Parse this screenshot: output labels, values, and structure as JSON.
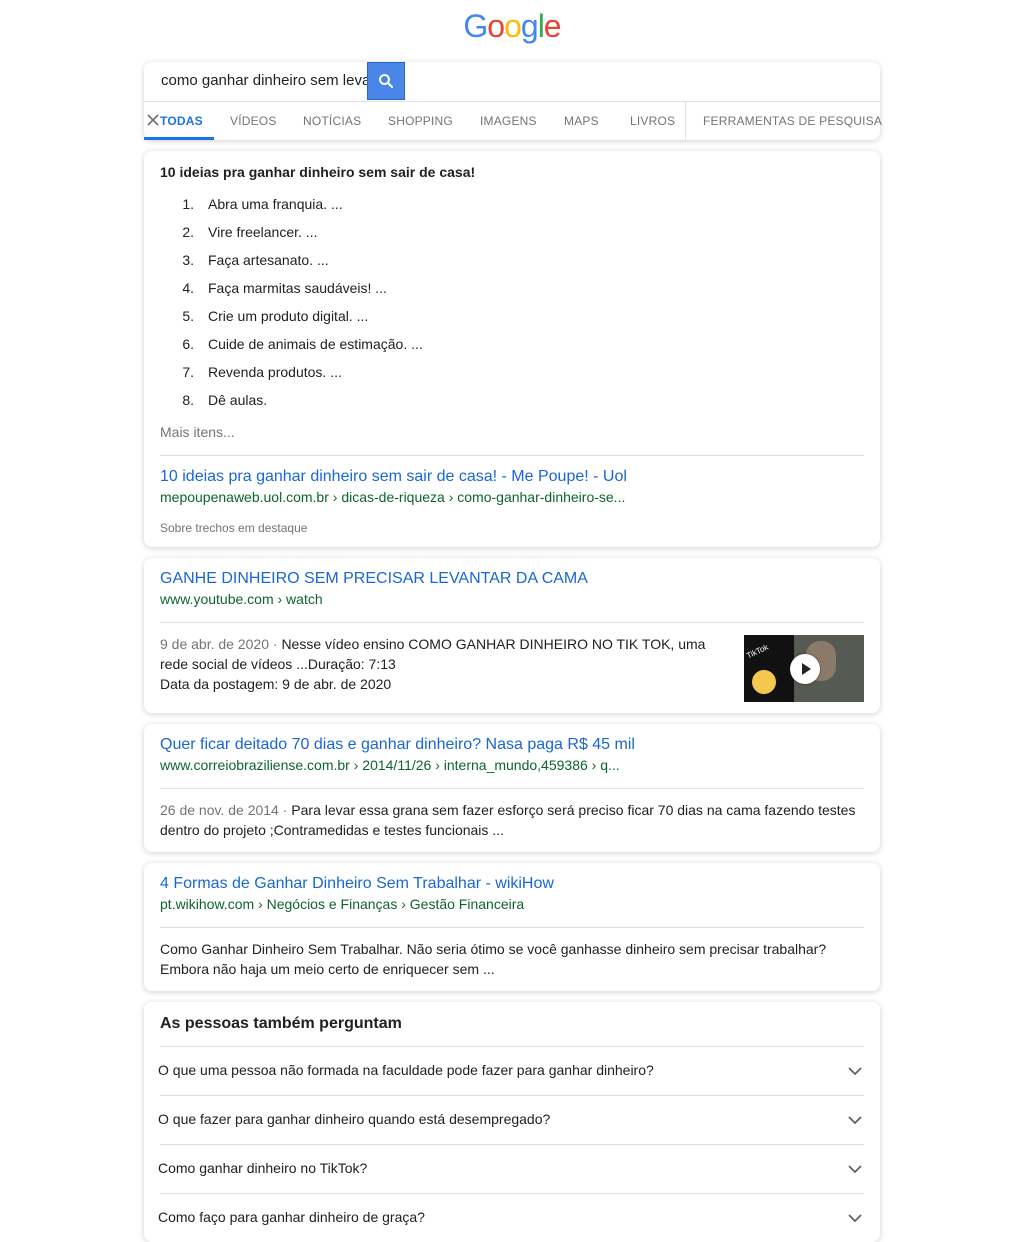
{
  "logo": {
    "letters": [
      "G",
      "o",
      "o",
      "g",
      "l",
      "e"
    ],
    "colors": [
      "#4285f4",
      "#ea4335",
      "#fbbc05",
      "#4285f4",
      "#34a853",
      "#ea4335"
    ]
  },
  "search": {
    "query": "como ganhar dinheiro sem leva"
  },
  "tabs": [
    {
      "label": "TODAS",
      "active": true
    },
    {
      "label": "VÍDEOS"
    },
    {
      "label": "NOTÍCIAS"
    },
    {
      "label": "SHOPPING"
    },
    {
      "label": "IMAGENS"
    },
    {
      "label": "MAPS"
    },
    {
      "label": "LIVROS"
    },
    {
      "label": "FERRAMENTAS DE PESQUISA"
    }
  ],
  "featured": {
    "title": "10 ideias pra ganhar dinheiro sem sair de casa!",
    "items": [
      "Abra uma franquia. ...",
      "Vire freelancer. ...",
      "Faça artesanato. ...",
      "Faça marmitas saudáveis! ...",
      "Crie um produto digital. ...",
      "Cuide de animais de estimação. ...",
      "Revenda produtos. ...",
      "Dê aulas."
    ],
    "more": "Mais itens...",
    "link_title": "10 ideias pra ganhar dinheiro sem sair de casa! - Me Poupe! - Uol",
    "url_domain": "mepoupenaweb.uol.com.br",
    "url_path": " › dicas-de-riqueza › como-ganhar-dinheiro-se...",
    "about": "Sobre trechos em destaque"
  },
  "results": [
    {
      "title": "GANHE DINHEIRO SEM PRECISAR LEVANTAR DA CAMA",
      "url_domain": "www.youtube.com",
      "url_path": " › watch",
      "date": "9 de abr. de 2020 · ",
      "snippet": "Nesse vídeo ensino COMO GANHAR DINHEIRO NO TIK TOK, uma rede social de vídeos ...Duração: 7:13",
      "extra": "Data da postagem: 9 de abr. de 2020",
      "thumb_label": "TikTok"
    },
    {
      "title": "Quer ficar deitado 70 dias e ganhar dinheiro? Nasa paga R$ 45 mil",
      "url_domain": "www.correiobraziliense.com.br",
      "url_path": " › 2014/11/26 › interna_mundo,459386 › q...",
      "date": "26 de nov. de 2014 · ",
      "snippet": "Para levar essa grana sem fazer esforço será preciso ficar 70 dias na cama fazendo testes dentro do projeto ;Contramedidas e testes funcionais ..."
    },
    {
      "title": "4 Formas de Ganhar Dinheiro Sem Trabalhar - wikiHow",
      "url_domain": "pt.wikihow.com",
      "url_path": " › Negócios e Finanças › Gestão Financeira",
      "snippet": "Como Ganhar Dinheiro Sem Trabalhar. Não seria ótimo se você ganhasse dinheiro sem precisar trabalhar? Embora não haja um meio certo de enriquecer sem ..."
    }
  ],
  "paa": {
    "title": "As pessoas também perguntam",
    "questions": [
      "O que uma pessoa não formada na faculdade pode fazer para ganhar dinheiro?",
      "O que fazer para ganhar dinheiro quando está desempregado?",
      "Como ganhar dinheiro no TikTok?",
      "Como faço para ganhar dinheiro de graça?"
    ]
  }
}
